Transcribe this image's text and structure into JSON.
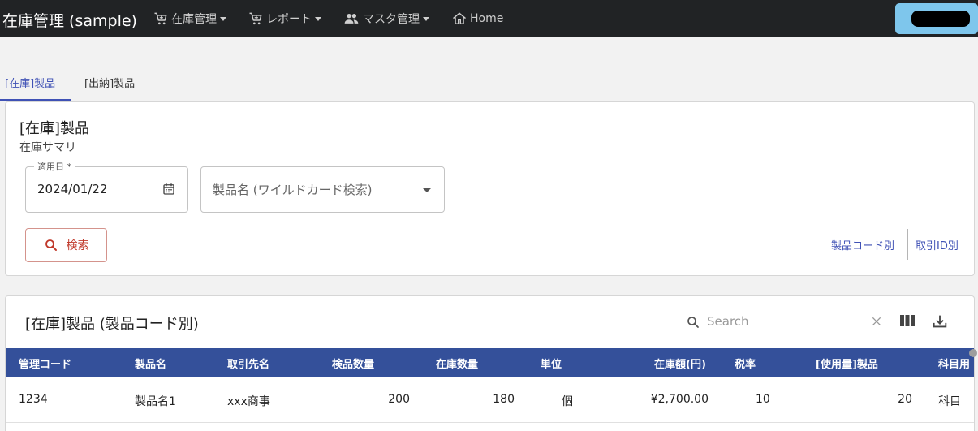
{
  "app": {
    "title": "在庫管理 (sample)"
  },
  "nav": {
    "items": [
      {
        "label": "在庫管理",
        "icon": "cart-icon"
      },
      {
        "label": "レポート",
        "icon": "cart-icon"
      },
      {
        "label": "マスタ管理",
        "icon": "people-icon"
      },
      {
        "label": "Home",
        "icon": "home-icon"
      }
    ]
  },
  "tabs": [
    {
      "label": "[在庫]製品",
      "active": true
    },
    {
      "label": "[出納]製品",
      "active": false
    }
  ],
  "search_card": {
    "title": "[在庫]製品",
    "subtitle": "在庫サマリ",
    "date_label": "適用日 *",
    "date_value": "2024/01/22",
    "product_placeholder": "製品名 (ワイルドカード検索)",
    "search_button": "検索",
    "links": [
      "製品コード別",
      "取引ID別"
    ]
  },
  "grid": {
    "title": "[在庫]製品 (製品コード別)",
    "search_placeholder": "Search",
    "columns": [
      "管理コード",
      "製品名",
      "取引先名",
      "検品数量",
      "在庫数量",
      "単位",
      "在庫額(円)",
      "税率",
      "[使用量]製品",
      "科目用"
    ],
    "rows": [
      [
        "1234",
        "製品名1",
        "xxx商事",
        "200",
        "180",
        "個",
        "¥2,700.00",
        "10",
        "20",
        "科目"
      ]
    ]
  },
  "colors": {
    "topbar": "#212325",
    "accent": "#3f51b5",
    "header": "#34509a",
    "user_button": "#7ec6ec",
    "search_button": "#c0392b"
  }
}
